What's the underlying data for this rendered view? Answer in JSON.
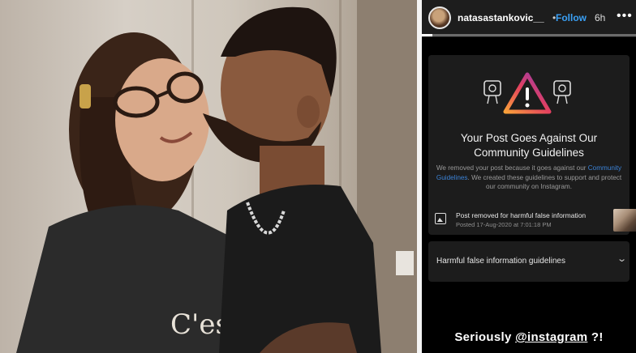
{
  "story": {
    "username": "natasastankovic__",
    "separator": "•",
    "follow_label": "Follow",
    "time": "6h",
    "more_icon": "more-horizontal-icon",
    "progress": 0.05
  },
  "notice": {
    "icon": "warning-community-icon",
    "title": "Your Post Goes Against Our Community Guidelines",
    "desc_before": "We removed your post because it goes against our ",
    "desc_link": "Community Guidelines",
    "desc_after": ". We created these guidelines to support and protect our community on Instagram.",
    "removed_title": "Post removed for harmful false information",
    "removed_date": "Posted 17-Aug-2020 at 7:01:18 PM"
  },
  "guidelines": {
    "label": "Harmful false information guidelines",
    "chevron": "chevron-down-icon"
  },
  "caption": {
    "before": "Seriously ",
    "mention": "@instagram",
    "after": " ?!"
  },
  "photo": {
    "shirt_text": "C'est"
  },
  "colors": {
    "follow": "#3aa0f5",
    "link": "#3b82d6",
    "warning_gradient": [
      "#f9a13a",
      "#e4405f",
      "#8a3ab9"
    ]
  }
}
